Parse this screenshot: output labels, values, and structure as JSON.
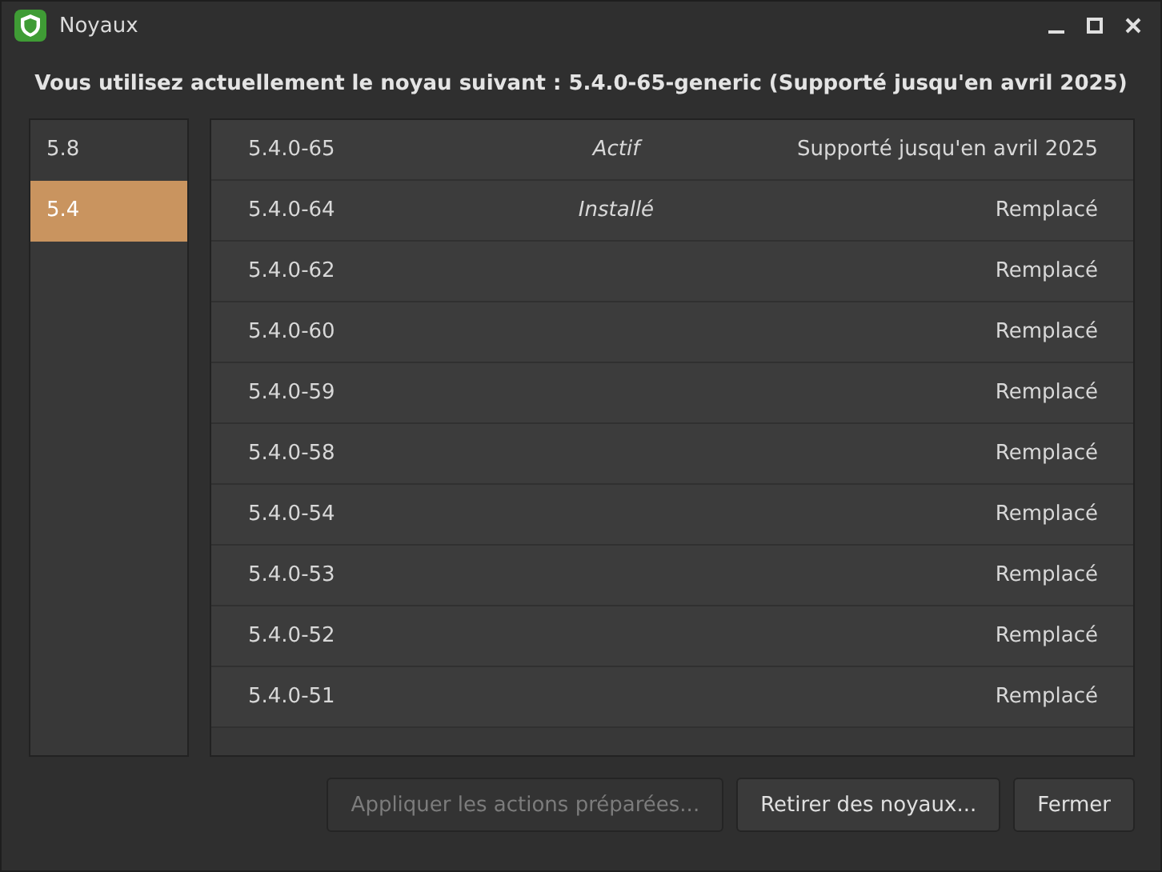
{
  "window": {
    "title": "Noyaux"
  },
  "headline": "Vous utilisez actuellement le noyau suivant : 5.4.0-65-generic (Supporté jusqu'en avril 2025)",
  "series": [
    {
      "label": "5.8",
      "selected": false
    },
    {
      "label": "5.4",
      "selected": true
    }
  ],
  "kernels": [
    {
      "version": "5.4.0-65",
      "status": "Actif",
      "support": "Supporté jusqu'en avril 2025"
    },
    {
      "version": "5.4.0-64",
      "status": "Installé",
      "support": "Remplacé"
    },
    {
      "version": "5.4.0-62",
      "support": "Remplacé"
    },
    {
      "version": "5.4.0-60",
      "support": "Remplacé"
    },
    {
      "version": "5.4.0-59",
      "support": "Remplacé"
    },
    {
      "version": "5.4.0-58",
      "support": "Remplacé"
    },
    {
      "version": "5.4.0-54",
      "support": "Remplacé"
    },
    {
      "version": "5.4.0-53",
      "support": "Remplacé"
    },
    {
      "version": "5.4.0-52",
      "support": "Remplacé"
    },
    {
      "version": "5.4.0-51",
      "support": "Remplacé"
    }
  ],
  "buttons": [
    {
      "label": "Appliquer les actions préparées...",
      "disabled": true
    },
    {
      "label": "Retirer des noyaux...",
      "disabled": false
    },
    {
      "label": "Fermer",
      "disabled": false
    }
  ]
}
